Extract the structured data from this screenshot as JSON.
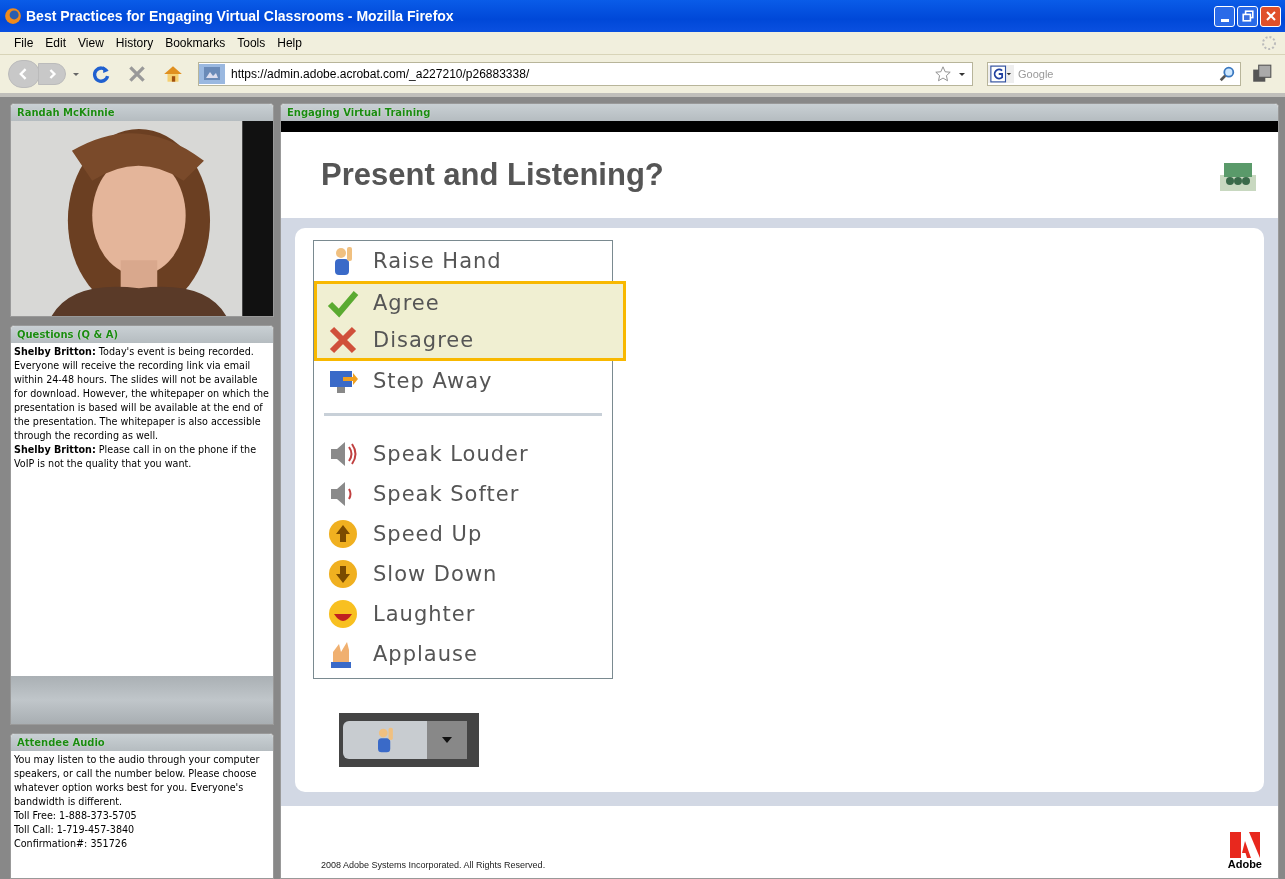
{
  "window": {
    "title": "Best Practices for Engaging Virtual Classrooms - Mozilla Firefox"
  },
  "menu": [
    "File",
    "Edit",
    "View",
    "History",
    "Bookmarks",
    "Tools",
    "Help"
  ],
  "address": {
    "value": "https://admin.adobe.acrobat.com/_a227210/p26883338/"
  },
  "search": {
    "placeholder": "Google"
  },
  "camera_pod": {
    "title": "Randah McKinnie"
  },
  "qa_pod": {
    "title": "Questions (Q & A)",
    "messages": [
      {
        "text": "**Shelby Britton:** Today's event is being recorded. Everyone will receive the recording link via email within 24-48 hours. The slides will not be available for download. However, the whitepaper on which the presentation is based will be available at the end of the presentation.  The whitepaper is also accessible through the recording as well."
      },
      {
        "text": "**Shelby Britton:** Please call in on the phone if the VoIP is not the quality that you want."
      }
    ]
  },
  "audio_pod": {
    "title": "Attendee Audio",
    "lines": [
      "You may listen to the audio through your computer speakers, or call the number below. Please choose whatever option works best for you. Everyone's bandwidth is different.",
      "Toll Free: 1-888-373-5705",
      "Toll Call: 1-719-457-3840",
      "Confirmation#: 351726"
    ]
  },
  "share_pod": {
    "title": "Engaging Virtual Training",
    "slide_title": "Present and Listening?",
    "status_groups": [
      [
        {
          "label": "Raise Hand",
          "highlighted": false
        },
        {
          "label": "Agree",
          "highlighted": true
        },
        {
          "label": "Disagree",
          "highlighted": true
        },
        {
          "label": "Step Away",
          "highlighted": false
        }
      ],
      [
        {
          "label": "Speak Louder",
          "highlighted": false
        },
        {
          "label": "Speak Softer",
          "highlighted": false
        },
        {
          "label": "Speed Up",
          "highlighted": false
        },
        {
          "label": "Slow Down",
          "highlighted": false
        },
        {
          "label": "Laughter",
          "highlighted": false
        },
        {
          "label": "Applause",
          "highlighted": false
        }
      ]
    ],
    "footer": "2008 Adobe Systems Incorporated. All Rights Reserved.",
    "logo_text": "Adobe"
  }
}
